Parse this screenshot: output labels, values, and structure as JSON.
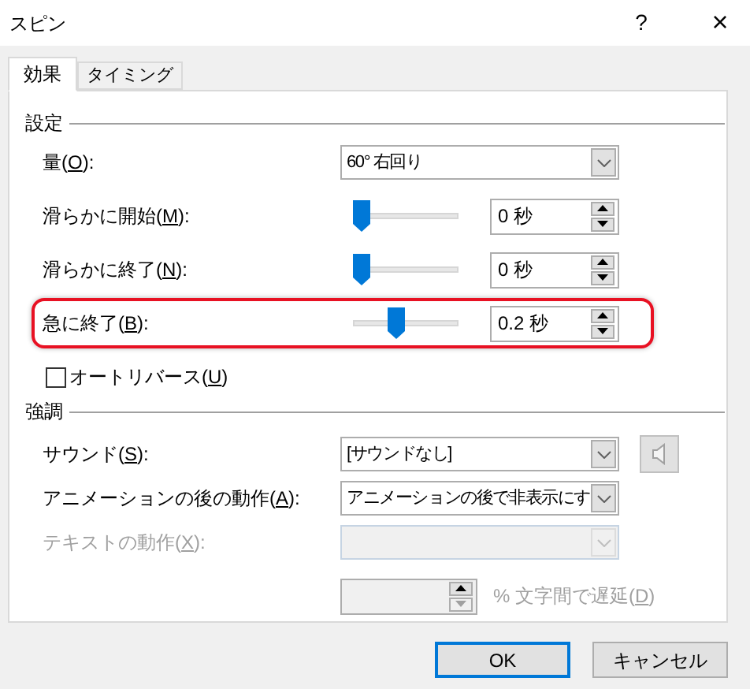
{
  "window": {
    "title": "スピン",
    "help": "?",
    "close": "×"
  },
  "tabs": [
    {
      "label": "効果",
      "selected": true
    },
    {
      "label": "タイミング",
      "selected": false
    }
  ],
  "settings": {
    "heading": "設定",
    "rows": [
      {
        "kind": "dropdown",
        "label": "量(",
        "key": "O",
        "label_end": "):",
        "value": "60° 右回り",
        "highlighted": false
      },
      {
        "kind": "slider",
        "label": "滑らかに開始(",
        "key": "M",
        "label_end": "):",
        "level": 0,
        "value": "0 秒",
        "highlighted": false
      },
      {
        "kind": "slider",
        "label": "滑らかに終了(",
        "key": "N",
        "label_end": "):",
        "level": 0,
        "value": "0 秒",
        "highlighted": false
      },
      {
        "kind": "slider",
        "label": "急に終了(",
        "key": "B",
        "label_end": "):",
        "level": 0.4,
        "value": "0.2 秒",
        "highlighted": true
      }
    ],
    "auto_reverse": {
      "label": "オートリバース(",
      "key": "U",
      "label_end": ")",
      "checked": false
    }
  },
  "enhancements": {
    "heading": "強調",
    "rows": [
      {
        "kind": "dropdown",
        "label": "サウンド(",
        "key": "S",
        "label_end": "):",
        "value": "[サウンドなし]",
        "disabled": false,
        "sound_button": true
      },
      {
        "kind": "dropdown",
        "label": "アニメーションの後の動作(",
        "key": "A",
        "label_end": "):",
        "value": "アニメーションの後で非表示にす",
        "disabled": false,
        "sound_button": false
      },
      {
        "kind": "dropdown",
        "label": "テキストの動作(",
        "key": "X",
        "label_end": "):",
        "disabled": true,
        "sound_button": false
      },
      {
        "kind": "spin",
        "label": "% 文字間で遅延(",
        "key": "D",
        "label_end": ")",
        "disabled": true,
        "sound_button": false
      }
    ]
  },
  "buttons": [
    {
      "label": "OK",
      "default": true
    },
    {
      "label": "キャンセル",
      "default": false
    }
  ]
}
